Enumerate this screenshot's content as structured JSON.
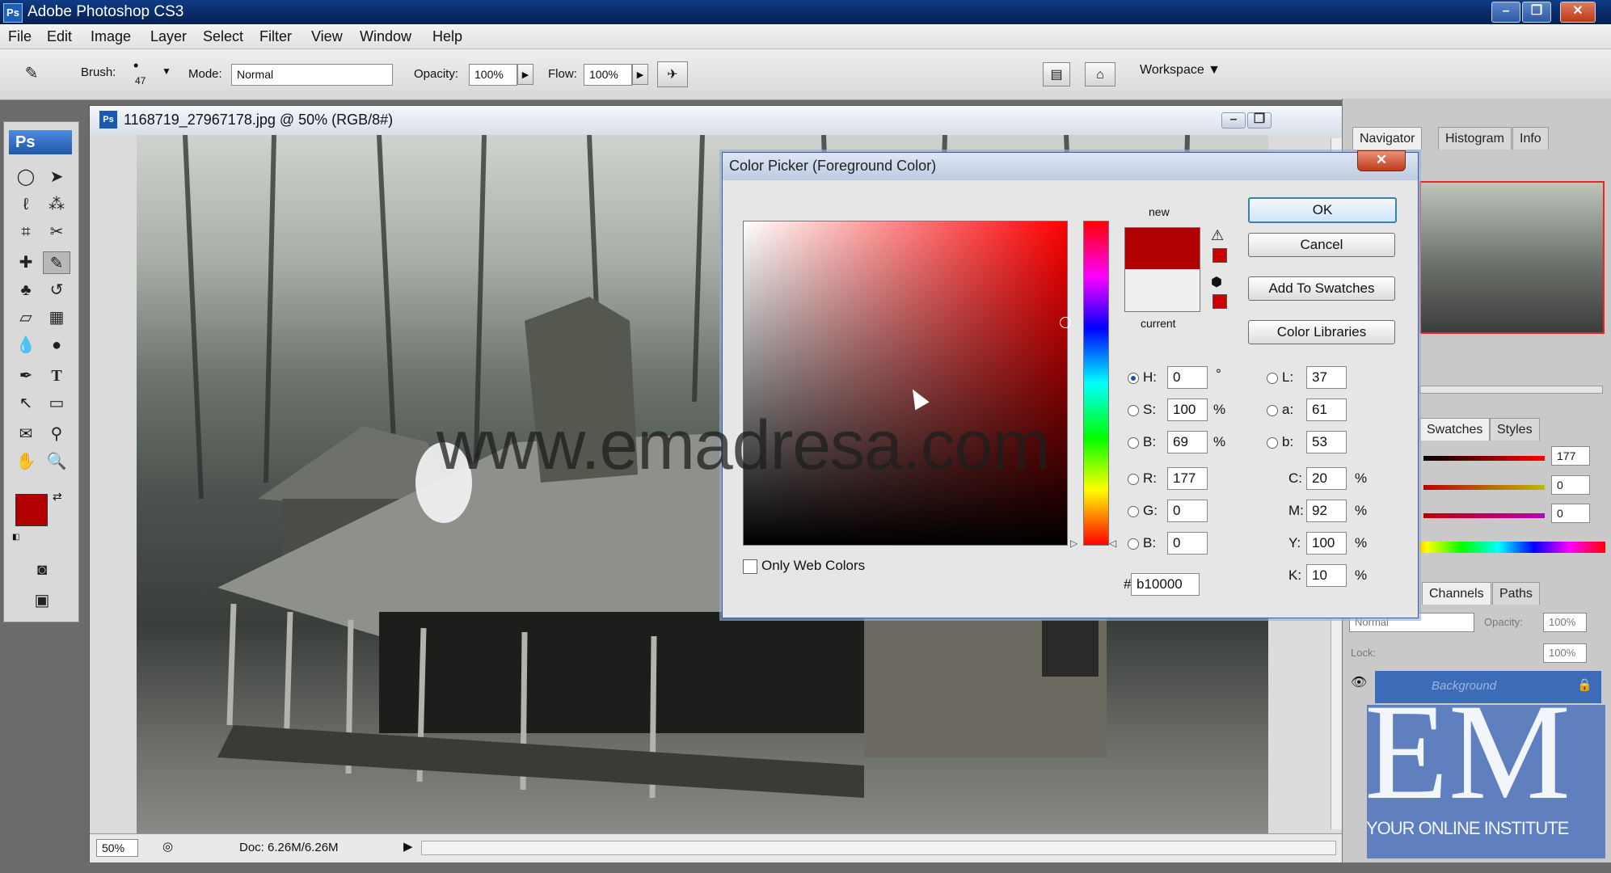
{
  "app": {
    "title": "Adobe Photoshop CS3",
    "logo": "Ps"
  },
  "menu": [
    "File",
    "Edit",
    "Image",
    "Layer",
    "Select",
    "Filter",
    "View",
    "Window",
    "Help"
  ],
  "options": {
    "brush_label": "Brush:",
    "brush_size": "47",
    "mode_label": "Mode:",
    "mode_value": "Normal",
    "opacity_label": "Opacity:",
    "opacity_value": "100%",
    "flow_label": "Flow:",
    "flow_value": "100%",
    "workspace_label": "Workspace ▼"
  },
  "toolbox": {
    "logo": "Ps"
  },
  "document": {
    "title": "1168719_27967178.jpg @ 50% (RGB/8#)",
    "zoom": "50%",
    "doc_info": "Doc: 6.26M/6.26M",
    "watermark": "www.emadresa.com"
  },
  "panels": {
    "top_tabs": [
      "Navigator",
      "Histogram",
      "Info"
    ],
    "mid_tabs": [
      "Swatches",
      "Styles"
    ],
    "low_tabs": [
      "Channels",
      "Paths"
    ],
    "slider_values": [
      "177",
      "0",
      "0"
    ],
    "layer_mode": "Normal",
    "layer_opacity_label": "Opacity:",
    "layer_opacity": "100%",
    "lock_label": "Lock:",
    "fill_value": "100%",
    "layer_name": "Background"
  },
  "dialog": {
    "title": "Color Picker (Foreground Color)",
    "new_label": "new",
    "current_label": "current",
    "buttons": {
      "ok": "OK",
      "cancel": "Cancel",
      "add_swatches": "Add To Swatches",
      "libraries": "Color Libraries"
    },
    "web_only": "Only Web Colors",
    "hex_label": "#",
    "hex": "b10000",
    "new_color": "#b10000",
    "current_color": "#efefef",
    "hsb": {
      "H": "0",
      "S": "100",
      "B": "69",
      "h_unit": "°",
      "pct": "%"
    },
    "rgb": {
      "R": "177",
      "G": "0",
      "B": "0"
    },
    "lab": {
      "L": "37",
      "a": "61",
      "b": "53"
    },
    "cmyk": {
      "C": "20",
      "M": "92",
      "Y": "100",
      "K": "10"
    },
    "labels": {
      "H": "H:",
      "S": "S:",
      "B": "B:",
      "R": "R:",
      "G": "G:",
      "B2": "B:",
      "L": "L:",
      "a": "a:",
      "b": "b:",
      "C": "C:",
      "M": "M:",
      "Y": "Y:",
      "K": "K:"
    }
  },
  "branding": {
    "logo": "EM",
    "tagline": "YOUR ONLINE INSTITUTE"
  }
}
